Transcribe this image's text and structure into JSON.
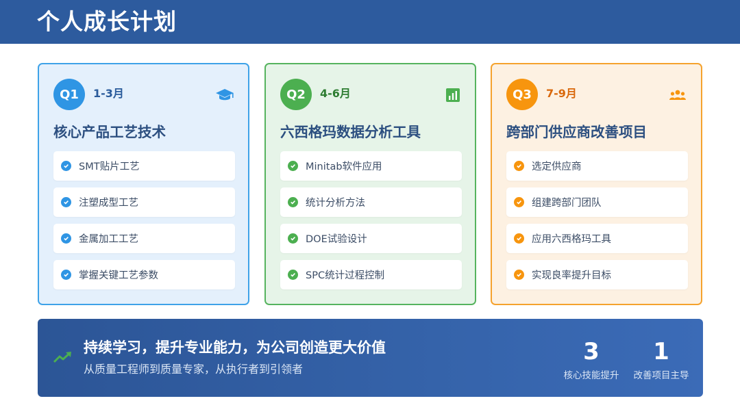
{
  "header": {
    "title": "个人成长计划"
  },
  "cards": [
    {
      "badge": "Q1",
      "period": "1-3月",
      "icon": "graduation-cap-icon",
      "title": "核心产品工艺技术",
      "accent": "#2f95e4",
      "items": [
        "SMT贴片工艺",
        "注塑成型工艺",
        "金属加工工艺",
        "掌握关键工艺参数"
      ]
    },
    {
      "badge": "Q2",
      "period": "4-6月",
      "icon": "bar-chart-icon",
      "title": "六西格玛数据分析工具",
      "accent": "#4caf50",
      "items": [
        "Minitab软件应用",
        "统计分析方法",
        "DOE试验设计",
        "SPC统计过程控制"
      ]
    },
    {
      "badge": "Q3",
      "period": "7-9月",
      "icon": "people-group-icon",
      "title": "跨部门供应商改善项目",
      "accent": "#f7950e",
      "items": [
        "选定供应商",
        "组建跨部门团队",
        "应用六西格玛工具",
        "实现良率提升目标"
      ]
    }
  ],
  "banner": {
    "icon": "trending-up-icon",
    "title": "持续学习，提升专业能力，为公司创造更大价值",
    "subtitle": "从质量工程师到质量专家，从执行者到引领者",
    "stats": [
      {
        "value": "3",
        "label": "核心技能提升"
      },
      {
        "value": "1",
        "label": "改善项目主导"
      }
    ]
  }
}
